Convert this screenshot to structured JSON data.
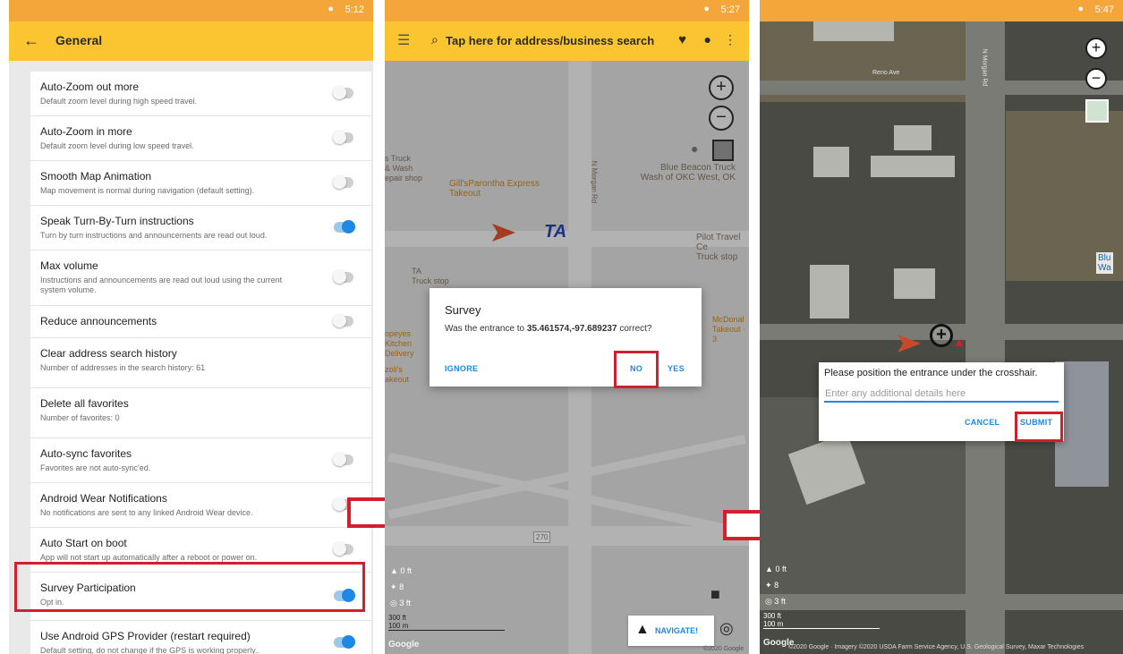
{
  "panel1": {
    "status": {
      "time": "5:12",
      "location_icon": "location-icon"
    },
    "appbar": {
      "title": "General",
      "back_icon": "back-arrow-icon"
    },
    "settings": [
      {
        "title": "Auto-Zoom out more",
        "subtitle": "Default zoom level during high speed travel.",
        "toggle": false
      },
      {
        "title": "Auto-Zoom in more",
        "subtitle": "Default zoom level during low speed travel.",
        "toggle": false
      },
      {
        "title": "Smooth Map Animation",
        "subtitle": "Map movement is normal during navigation (default setting).",
        "toggle": false
      },
      {
        "title": "Speak Turn-By-Turn instructions",
        "subtitle": "Turn by turn instructions and announcements are read out loud.",
        "toggle": true
      },
      {
        "title": "Max volume",
        "subtitle": "Instructions and announcements are read out loud using the current system volume.",
        "toggle": false
      },
      {
        "title": "Reduce announcements",
        "subtitle": "",
        "toggle": false
      },
      {
        "title": "Clear address search history",
        "subtitle": "Number of addresses in the search history: 61"
      },
      {
        "title": "Delete all favorites",
        "subtitle": "Number of favorites: 0"
      },
      {
        "title": "Auto-sync favorites",
        "subtitle": "Favorites are not auto-sync'ed.",
        "toggle": false
      },
      {
        "title": "Android Wear Notifications",
        "subtitle": "No notifications are sent to any linked Android Wear device.",
        "toggle": false
      },
      {
        "title": "Auto Start on boot",
        "subtitle": "App will not start up automatically after a reboot or power on.",
        "toggle": false
      },
      {
        "title": "Survey Participation",
        "subtitle": "Opt in.",
        "toggle": true
      },
      {
        "title": "Use Android GPS Provider (restart required)",
        "subtitle": "Default setting, do not change if the GPS is working properly..",
        "toggle": true
      }
    ]
  },
  "panel2": {
    "status": {
      "time": "5:27"
    },
    "search_placeholder": "Tap here for address/business search",
    "pois": {
      "truck_wash_left": "s Truck",
      "truck_wash_left2": "& Wash",
      "truck_wash_left3": "epair shop",
      "gills": "Gill'sParontha Express",
      "gills_sub": "Takeout",
      "blue_beacon": "Blue Beacon Truck",
      "blue_beacon2": "Wash of OKC West, OK",
      "pilot": "Pilot Travel Ce",
      "pilot_sub": "Truck stop",
      "ta_label": "TA",
      "ta_stop": "Truck stop",
      "popeyes1": "opeyes",
      "popeyes2": "Kitchen",
      "popeyes3": "Delivery",
      "zolis": "zoli's",
      "zolis_sub": "akeout",
      "mcdonalds": "McDonal",
      "mcdonalds_sub": "Takeout · 3",
      "road_label": "N Morgan Rd"
    },
    "dialog": {
      "title": "Survey",
      "message_prefix": "Was the entrance to ",
      "coords": "35.461574,-97.689237",
      "message_suffix": " correct?",
      "ignore": "IGNORE",
      "no": "NO",
      "yes": "YES"
    },
    "stats": {
      "altitude": "0 ft",
      "satellites": "8",
      "accuracy": "3 ft"
    },
    "scale": {
      "ft": "300 ft",
      "m": "100 m"
    },
    "navigate": "NAVIGATE!",
    "google": "Google",
    "copyright": "©2020 Google",
    "highway": "270"
  },
  "panel3": {
    "status": {
      "time": "5:47"
    },
    "dialog": {
      "title": "Please position the entrance under the crosshair.",
      "placeholder": "Enter any additional details here",
      "cancel": "CANCEL",
      "submit": "SUBMIT"
    },
    "road_label": "Reno Ave",
    "road_label2": "N Morgan Rd",
    "poi": "Blu",
    "poi2": "Wa",
    "stats": {
      "altitude": "0 ft",
      "satellites": "8",
      "accuracy": "3 ft"
    },
    "scale": {
      "ft": "300 ft",
      "m": "100 m"
    },
    "google": "Google",
    "copyright": "©2020 Google · Imagery ©2020 USDA Farm Service Agency, U.S. Geological Survey, Maxar Technologies"
  },
  "colors": {
    "accent_yellow": "#fbc531",
    "status_orange": "#f4a63a",
    "highlight_red": "#d0202e",
    "blue": "#1e88e5"
  }
}
